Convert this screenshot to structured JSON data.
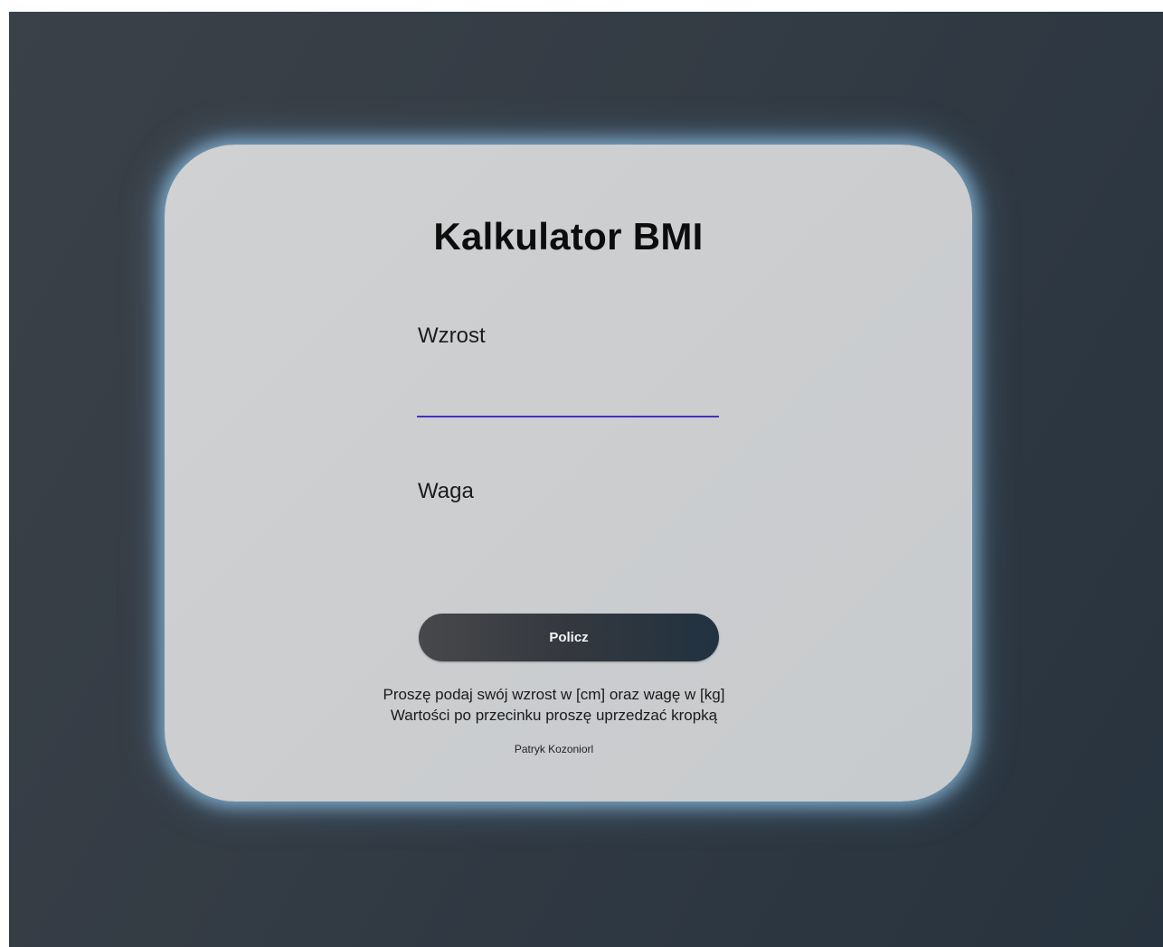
{
  "title": "Kalkulator BMI",
  "form": {
    "height_label": "Wzrost",
    "height_value": "",
    "weight_label": "Waga",
    "weight_value": "",
    "submit_label": "Policz"
  },
  "hints": {
    "line1": "Proszę podaj swój wzrost w [cm] oraz wagę w [kg]",
    "line2": "Wartości po przecinku proszę uprzedzać kropką"
  },
  "footer": {
    "author": "Patryk Kozoniorl"
  },
  "colors": {
    "background": "#333b44",
    "card": "#cdcfd1",
    "input_focus_underline": "#4a2fc0",
    "button_start": "#47484b",
    "button_end": "#213241",
    "glow": "#8cbee1"
  }
}
